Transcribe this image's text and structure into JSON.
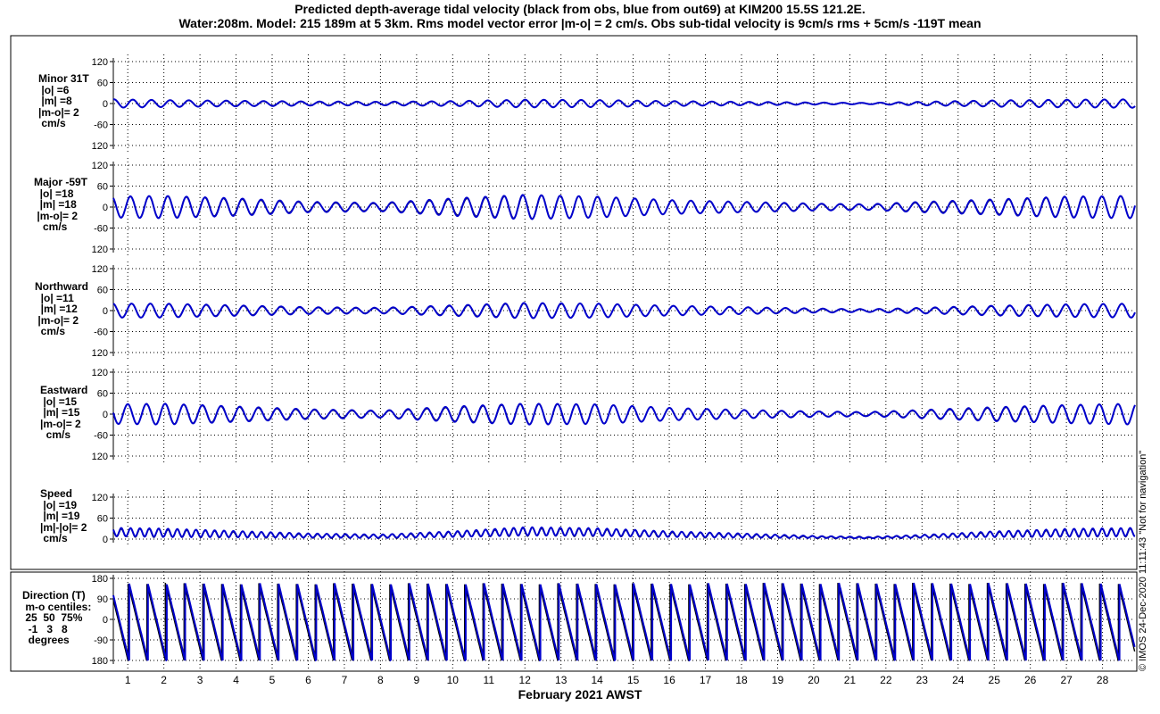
{
  "title_line1": "Predicted depth-average tidal velocity (black from obs, blue from out69) at KIM200 15.5S 121.2E.",
  "title_line2": "Water:208m. Model: 215 189m at 5 3km. Rms model vector error |m-o| = 2 cm/s. Obs sub-tidal velocity is 9cm/s rms + 5cm/s -119T mean",
  "xlabel": "February 2021 AWST",
  "credit": "© IMOS 24-Dec-2020 11:11:43  \"Not for navigation\"",
  "colors": {
    "model": "#0000cc",
    "obs": "#000000",
    "grid": "#000000"
  },
  "chart_data": [
    {
      "type": "line",
      "panel_label": "Minor 31T\n |o| =6\n |m| =8\n|m-o|= 2\n cm/s",
      "yticks": [
        120,
        60,
        0,
        -60,
        120
      ],
      "ylim": [
        -120,
        120
      ],
      "xlim": [
        0.6,
        28.9
      ],
      "xticks": [
        1,
        2,
        3,
        4,
        5,
        6,
        7,
        8,
        9,
        10,
        11,
        12,
        13,
        14,
        15,
        16,
        17,
        18,
        19,
        20,
        21,
        22,
        23,
        24,
        25,
        26,
        27,
        28
      ],
      "series": [
        {
          "values_model": {
            "x": [
              0.6,
              2,
              4,
              6,
              8,
              10,
              12,
              14,
              16,
              18,
              20,
              21.5,
              23,
              25,
              27,
              28.9
            ],
            "amplitude": [
              12,
              10,
              8,
              6,
              5,
              7,
              11,
              10,
              7,
              5,
              3,
              2,
              5,
              9,
              11,
              12
            ]
          }
        }
      ]
    },
    {
      "type": "line",
      "panel_label": "Major -59T\n  |o| =18\n  |m| =18\n |m-o|= 2\n   cm/s",
      "yticks": [
        120,
        60,
        0,
        -60,
        120
      ],
      "ylim": [
        -120,
        120
      ],
      "xlim": [
        0.6,
        28.9
      ],
      "series": [
        {
          "values_model": {
            "x": [
              0.6,
              2,
              4,
              6,
              8,
              10,
              12,
              14,
              16,
              18,
              20,
              21.5,
              23,
              25,
              27,
              28.9
            ],
            "amplitude": [
              30,
              32,
              25,
              15,
              12,
              25,
              35,
              30,
              20,
              15,
              10,
              8,
              15,
              22,
              30,
              32
            ]
          }
        }
      ]
    },
    {
      "type": "line",
      "panel_label": "Northward\n  |o| =11\n  |m| =12\n |m-o|= 2\n  cm/s",
      "yticks": [
        120,
        60,
        0,
        -60,
        120
      ],
      "ylim": [
        -120,
        120
      ],
      "xlim": [
        0.6,
        28.9
      ],
      "series": [
        {
          "values_model": {
            "x": [
              0.6,
              2,
              4,
              6,
              8,
              10,
              12,
              14,
              16,
              18,
              20,
              21.5,
              23,
              25,
              27,
              28.9
            ],
            "amplitude": [
              20,
              20,
              15,
              10,
              8,
              15,
              22,
              20,
              14,
              10,
              6,
              4,
              8,
              14,
              18,
              20
            ]
          }
        }
      ]
    },
    {
      "type": "line",
      "panel_label": "Eastward\n |o| =15\n |m| =15\n|m-o|= 2\n  cm/s",
      "yticks": [
        120,
        60,
        0,
        -60,
        120
      ],
      "ylim": [
        -120,
        120
      ],
      "xlim": [
        0.6,
        28.9
      ],
      "series": [
        {
          "values_model": {
            "x": [
              0.6,
              2,
              4,
              6,
              8,
              10,
              12,
              14,
              16,
              18,
              20,
              21.5,
              23,
              25,
              27,
              28.9
            ],
            "amplitude": [
              28,
              30,
              22,
              14,
              10,
              22,
              30,
              28,
              18,
              12,
              8,
              6,
              12,
              20,
              26,
              30
            ]
          }
        }
      ]
    },
    {
      "type": "line",
      "panel_label": "Speed\n |o| =19\n |m| =19\n|m|-|o|= 2\n cm/s",
      "yticks": [
        120,
        60,
        0
      ],
      "ylim": [
        0,
        120
      ],
      "xlim": [
        0.6,
        28.9
      ],
      "series": [
        {
          "values_model": {
            "x": [
              0.6,
              2,
              4,
              6,
              8,
              10,
              12,
              14,
              16,
              18,
              20,
              21.5,
              23,
              25,
              27,
              28.9
            ],
            "base": [
              20,
              18,
              14,
              10,
              8,
              14,
              22,
              20,
              14,
              10,
              6,
              4,
              8,
              14,
              18,
              20
            ],
            "amplitude": [
              12,
              12,
              9,
              6,
              5,
              8,
              12,
              11,
              8,
              6,
              3,
              2,
              4,
              8,
              11,
              12
            ]
          }
        }
      ]
    },
    {
      "type": "line",
      "panel_label": "Direction (T)\n m-o centiles:\n 25  50  75%\n  -1   3   8\n  degrees",
      "yticks": [
        180,
        90,
        0,
        -90,
        180
      ],
      "ylim": [
        -180,
        180
      ],
      "xlim": [
        0.6,
        28.9
      ],
      "series": [
        {
          "name_model": "model",
          "period_days": 0.5175
        }
      ]
    }
  ]
}
